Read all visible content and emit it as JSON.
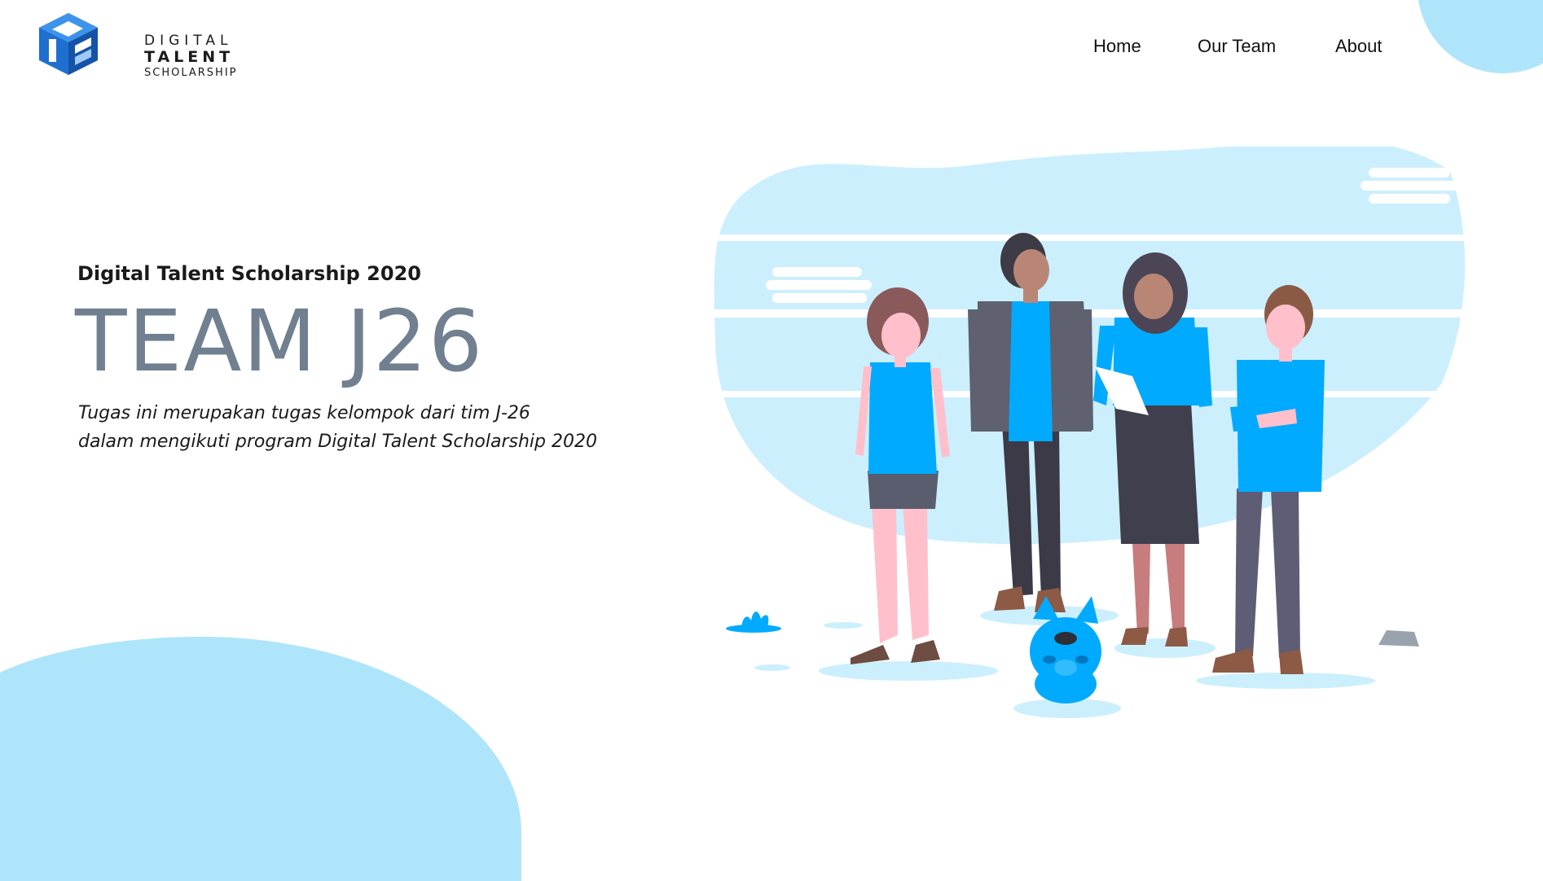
{
  "logo": {
    "line1": "DIGITAL",
    "line2": "TALENT",
    "line3": "SCHOLARSHIP"
  },
  "nav": {
    "items": [
      {
        "label": "Home"
      },
      {
        "label": "Our Team"
      },
      {
        "label": "About"
      }
    ]
  },
  "hero": {
    "subtitle": "Digital Talent Scholarship 2020",
    "title": "TEAM J26",
    "description_line1": "Tugas ini merupakan tugas kelompok dari tim J-26",
    "description_line2": "dalam mengikuti program Digital Talent Scholarship 2020"
  },
  "colors": {
    "accent_blue": "#00aaff",
    "light_blue": "#aee5fb",
    "title_gray": "#708090",
    "background": "#ffffff"
  }
}
